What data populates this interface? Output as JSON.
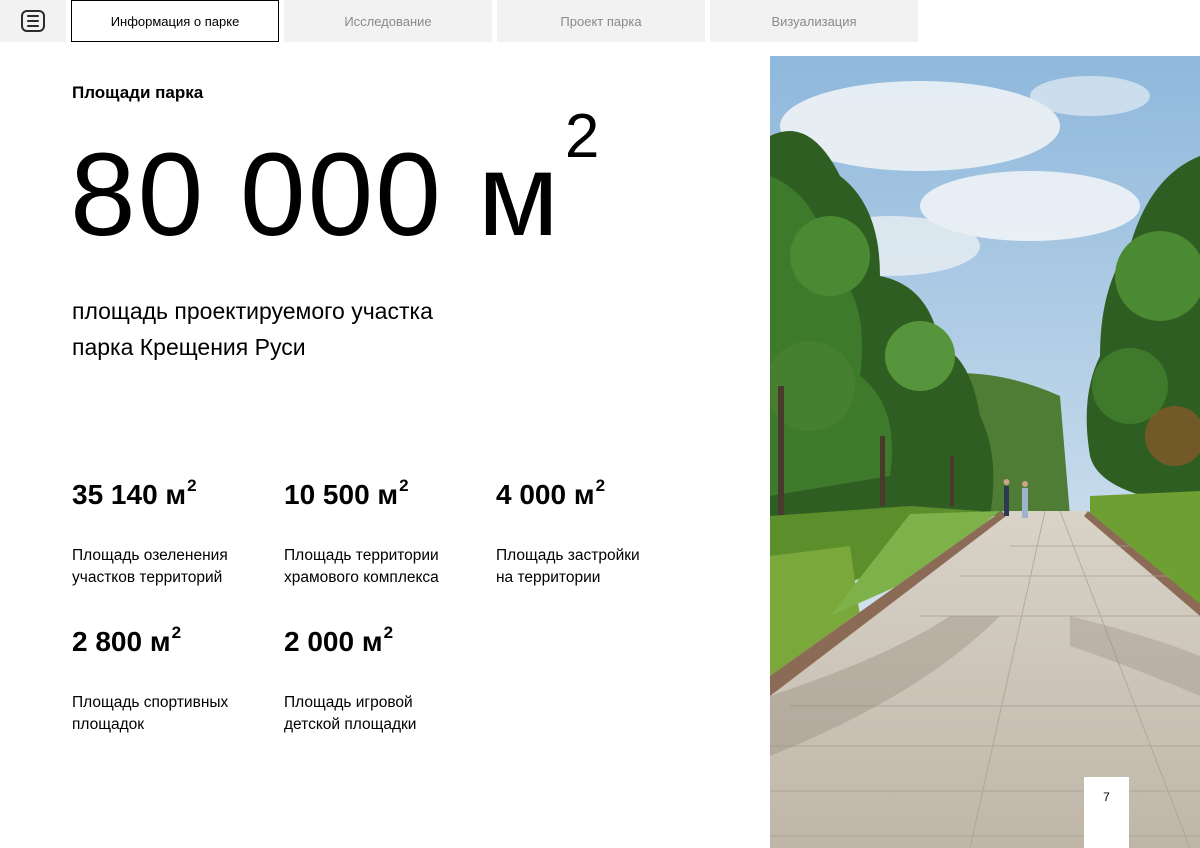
{
  "nav": {
    "menu_icon": "menu-icon",
    "tabs": [
      {
        "label": "Информация о парке",
        "active": true
      },
      {
        "label": "Исследование",
        "active": false
      },
      {
        "label": "Проект парка",
        "active": false
      },
      {
        "label": "Визуализация",
        "active": false
      }
    ]
  },
  "main": {
    "section_title": "Площади парка",
    "total_area": {
      "value": "80 000 м",
      "sup": "2"
    },
    "lead_line1": "площадь проектируемого участка",
    "lead_line2": "парка Крещения Руси",
    "stats": [
      {
        "value": "35 140 м",
        "sup": "2",
        "desc": "Площадь озеленения\nучастков территорий"
      },
      {
        "value": "10 500 м",
        "sup": "2",
        "desc": "Площадь территории\nхрамового комплекса"
      },
      {
        "value": "4 000 м",
        "sup": "2",
        "desc": "Площадь застройки\nна территории"
      },
      {
        "value": "2 800 м",
        "sup": "2",
        "desc": "Площадь спортивных\nплощадок"
      },
      {
        "value": "2 000 м",
        "sup": "2",
        "desc": "Площадь игровой\nдетской площадки"
      }
    ]
  },
  "photo": {
    "subject": "park-alley-photo"
  },
  "page_number": "7",
  "colors": {
    "tab_bg": "#f2f2f2",
    "tab_inactive_text": "#8a8a8a",
    "text": "#000000"
  }
}
